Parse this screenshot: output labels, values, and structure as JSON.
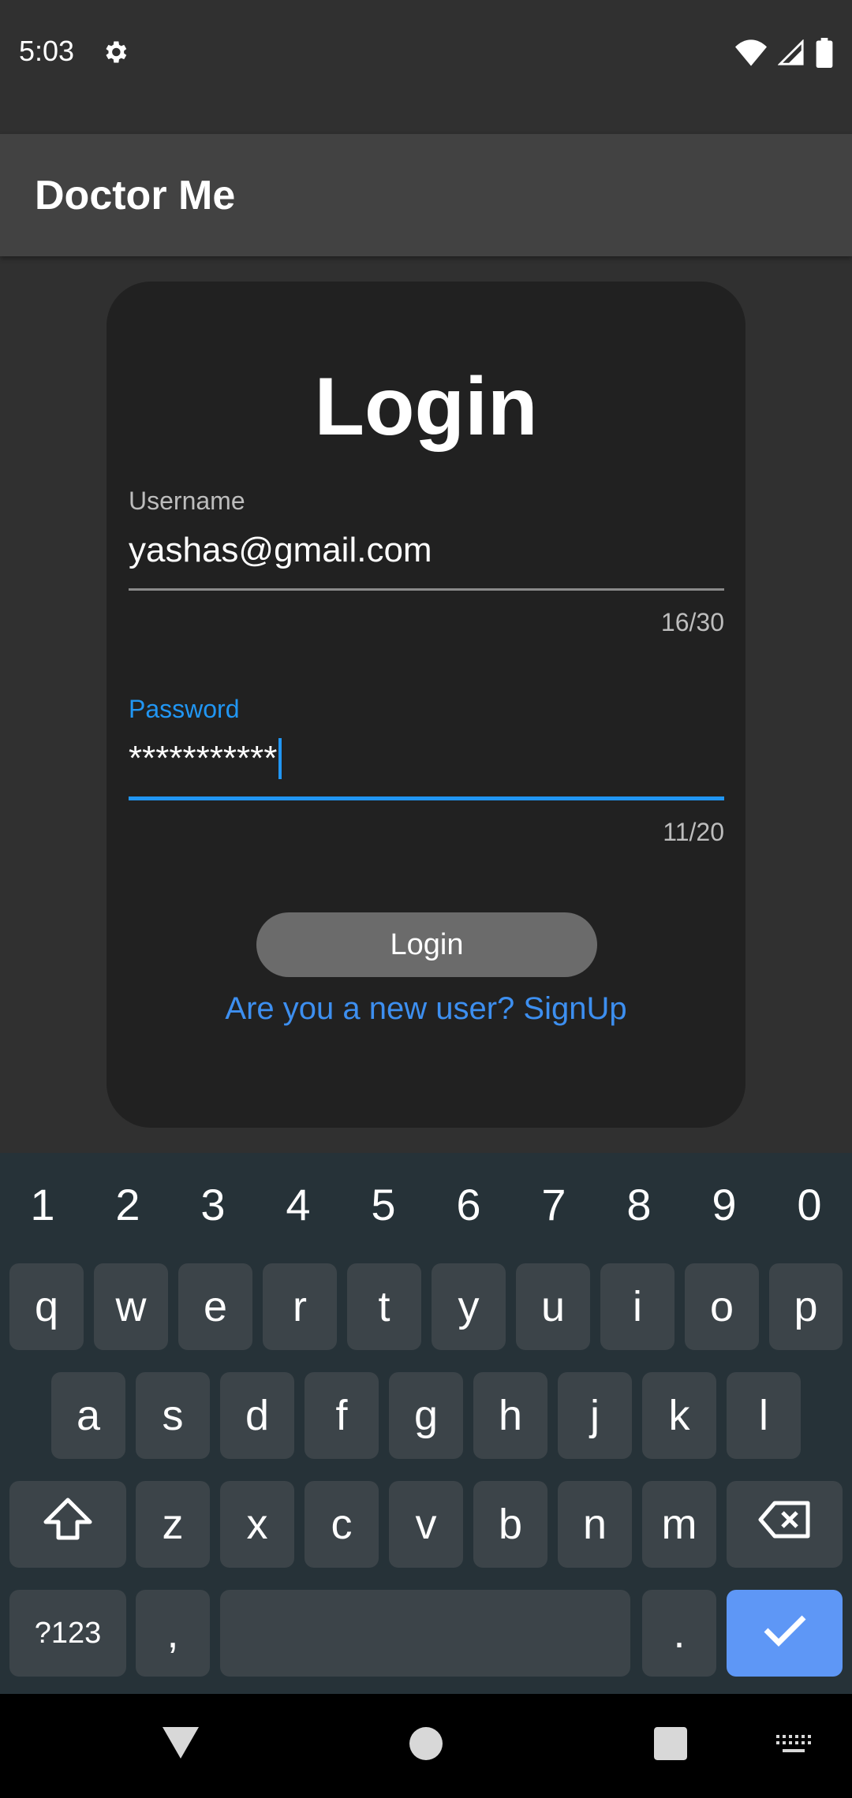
{
  "status_bar": {
    "time": "5:03"
  },
  "app_bar": {
    "title": "Doctor Me"
  },
  "login_card": {
    "title": "Login",
    "username": {
      "label": "Username",
      "value": "yashas@gmail.com",
      "counter": "16/30"
    },
    "password": {
      "label": "Password",
      "value": "***********",
      "counter": "11/20"
    },
    "login_button": "Login",
    "signup_link": "Are you a new user? SignUp"
  },
  "keyboard": {
    "numbers": [
      "1",
      "2",
      "3",
      "4",
      "5",
      "6",
      "7",
      "8",
      "9",
      "0"
    ],
    "row1": [
      "q",
      "w",
      "e",
      "r",
      "t",
      "y",
      "u",
      "i",
      "o",
      "p"
    ],
    "row2": [
      "a",
      "s",
      "d",
      "f",
      "g",
      "h",
      "j",
      "k",
      "l"
    ],
    "row3": [
      "z",
      "x",
      "c",
      "v",
      "b",
      "n",
      "m"
    ],
    "symbols_key": "?123",
    "comma_key": ",",
    "period_key": "."
  },
  "colors": {
    "accent": "#2196f3",
    "link": "#3d8ff0",
    "enter_key": "#5e97f6"
  }
}
